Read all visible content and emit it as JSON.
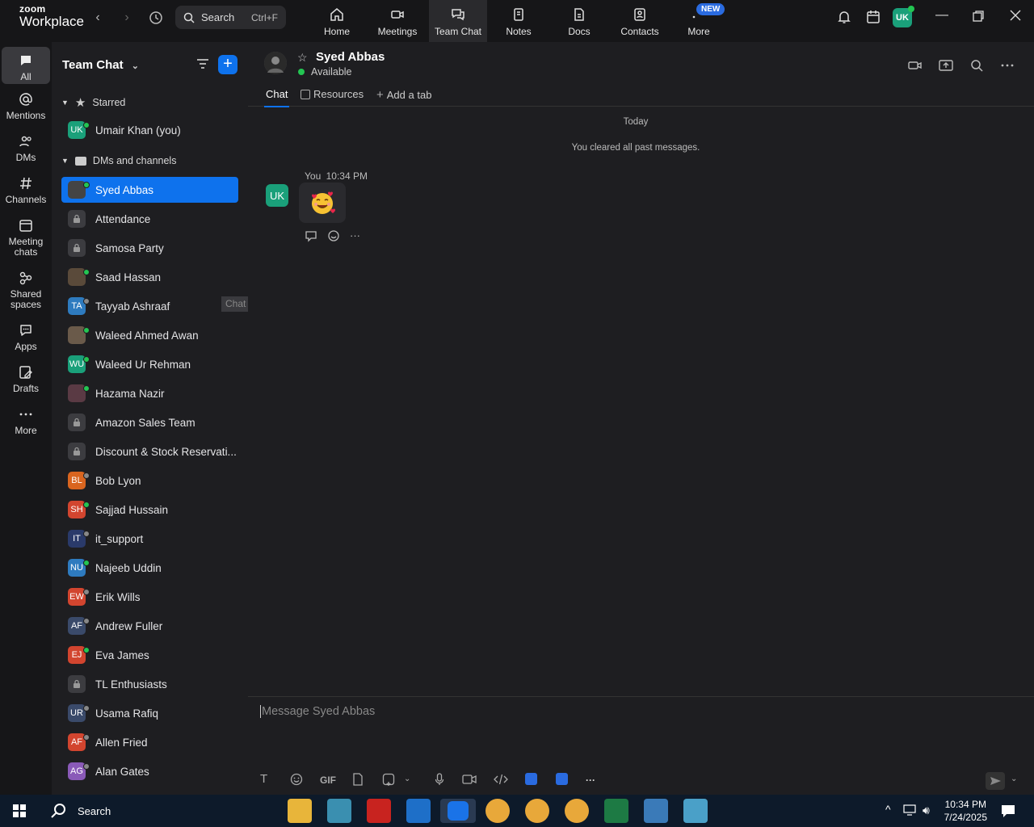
{
  "app": {
    "logo_line1": "zoom",
    "logo_line2": "Workplace"
  },
  "topbar": {
    "search_label": "Search",
    "search_shortcut": "Ctrl+F",
    "tabs": [
      {
        "label": "Home",
        "icon": "home-icon"
      },
      {
        "label": "Meetings",
        "icon": "video-camera-icon"
      },
      {
        "label": "Team Chat",
        "icon": "chat-bubbles-icon"
      },
      {
        "label": "Notes",
        "icon": "notes-icon"
      },
      {
        "label": "Docs",
        "icon": "document-icon"
      },
      {
        "label": "Contacts",
        "icon": "contacts-icon"
      },
      {
        "label": "More",
        "icon": "more-dots-icon"
      }
    ],
    "new_badge": "NEW",
    "avatar_initials": "UK"
  },
  "rail": {
    "items": [
      {
        "label": "All"
      },
      {
        "label": "Mentions"
      },
      {
        "label": "DMs"
      },
      {
        "label": "Channels"
      },
      {
        "label_line1": "Meeting",
        "label_line2": "chats"
      },
      {
        "label_line1": "Shared",
        "label_line2": "spaces"
      },
      {
        "label": "Apps"
      },
      {
        "label": "Drafts"
      },
      {
        "label": "More"
      }
    ]
  },
  "sidebar": {
    "title": "Team Chat",
    "sections": {
      "starred": "Starred",
      "dms": "DMs and channels"
    },
    "starred_items": [
      {
        "initials": "UK",
        "name": "Umair Khan (you)",
        "color": "#1aa07a",
        "status": "#23c552"
      }
    ],
    "items": [
      {
        "initials": "",
        "name": "Syed Abbas",
        "color": "#444",
        "status": "#23c552",
        "active": true
      },
      {
        "initials": "",
        "name": "Attendance",
        "color": "lock",
        "status": ""
      },
      {
        "initials": "",
        "name": "Samosa Party",
        "color": "lock",
        "status": ""
      },
      {
        "initials": "",
        "name": "Saad Hassan",
        "color": "#5a4a3a",
        "status": "#23c552"
      },
      {
        "initials": "TA",
        "name": "Tayyab Ashraaf",
        "color": "#2e7bbf",
        "status": "#888"
      },
      {
        "initials": "",
        "name": "Waleed Ahmed Awan",
        "color": "#6a5a4a",
        "status": "#23c552"
      },
      {
        "initials": "WU",
        "name": "Waleed Ur Rehman",
        "color": "#1aa07a",
        "status": "#23c552"
      },
      {
        "initials": "",
        "name": "Hazama Nazir",
        "color": "#5a3a44",
        "status": "#23c552"
      },
      {
        "initials": "",
        "name": "Amazon Sales Team",
        "color": "lock",
        "status": ""
      },
      {
        "initials": "",
        "name": "Discount & Stock Reservati...",
        "color": "lock",
        "status": ""
      },
      {
        "initials": "BL",
        "name": "Bob Lyon",
        "color": "#d9651f",
        "status": "#888"
      },
      {
        "initials": "SH",
        "name": "Sajjad Hussain",
        "color": "#d2452f",
        "status": "#23c552"
      },
      {
        "initials": "IT",
        "name": "it_support",
        "color": "#2a3a6a",
        "status": "#888"
      },
      {
        "initials": "NU",
        "name": "Najeeb Uddin",
        "color": "#2e7bbf",
        "status": "#23c552"
      },
      {
        "initials": "EW",
        "name": "Erik Wills",
        "color": "#d2452f",
        "status": "#888"
      },
      {
        "initials": "AF",
        "name": "Andrew Fuller",
        "color": "#3a4a6a",
        "status": "#888"
      },
      {
        "initials": "EJ",
        "name": "Eva James",
        "color": "#d2452f",
        "status": "#23c552"
      },
      {
        "initials": "",
        "name": "TL Enthusiasts",
        "color": "lock",
        "status": ""
      },
      {
        "initials": "UR",
        "name": "Usama Rafiq",
        "color": "#3a4a6a",
        "status": "#888"
      },
      {
        "initials": "AF",
        "name": "Allen Fried",
        "color": "#d2452f",
        "status": "#888"
      },
      {
        "initials": "AG",
        "name": "Alan Gates",
        "color": "#8a5ab8",
        "status": "#888"
      }
    ],
    "tooltip": "Chat options"
  },
  "chat": {
    "name": "Syed Abbas",
    "status": "Available",
    "tabs": [
      "Chat",
      "Resources",
      "Add a tab"
    ],
    "day_label": "Today",
    "system_message": "You cleared all past messages.",
    "message": {
      "author": "You",
      "time": "10:34 PM",
      "avatar_initials": "UK",
      "content_icon": "smiling-face-with-hearts-emoji"
    },
    "composer_placeholder": "Message Syed Abbas",
    "gif_label": "GIF"
  },
  "taskbar": {
    "search_label": "Search",
    "time": "10:34 PM",
    "date": "7/24/2025"
  }
}
